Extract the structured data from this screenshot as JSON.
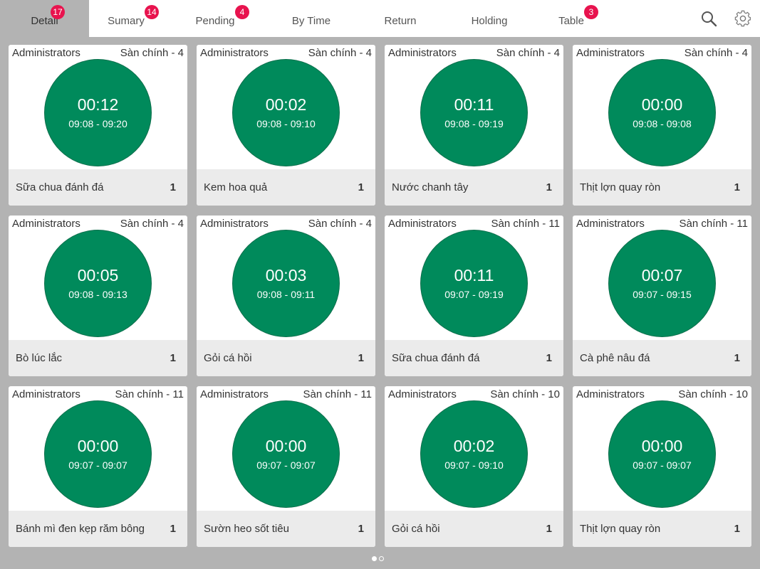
{
  "tabs": [
    {
      "label": "Detail",
      "badge": "17"
    },
    {
      "label": "Sumary",
      "badge": "14"
    },
    {
      "label": "Pending",
      "badge": "4"
    },
    {
      "label": "By Time",
      "badge": ""
    },
    {
      "label": "Return",
      "badge": ""
    },
    {
      "label": "Holding",
      "badge": ""
    },
    {
      "label": "Table",
      "badge": "3"
    }
  ],
  "active_tab": "Detail",
  "icons": {
    "search": "search-icon",
    "settings": "gear-icon"
  },
  "colors": {
    "timer": "#008a5b",
    "badge": "#e8134e",
    "background": "#b3b3b3"
  },
  "cards": [
    {
      "staff": "Administrators",
      "location": "Sàn chính - 4",
      "elapsed": "00:12",
      "range": "09:08 - 09:20",
      "dish": "Sữa chua đánh đá",
      "qty": "1"
    },
    {
      "staff": "Administrators",
      "location": "Sàn chính - 4",
      "elapsed": "00:02",
      "range": "09:08 - 09:10",
      "dish": "Kem hoa quả",
      "qty": "1"
    },
    {
      "staff": "Administrators",
      "location": "Sàn chính - 4",
      "elapsed": "00:11",
      "range": "09:08 - 09:19",
      "dish": "Nước chanh tây",
      "qty": "1"
    },
    {
      "staff": "Administrators",
      "location": "Sàn chính - 4",
      "elapsed": "00:00",
      "range": "09:08 - 09:08",
      "dish": "Thịt lợn quay ròn",
      "qty": "1"
    },
    {
      "staff": "Administrators",
      "location": "Sàn chính - 4",
      "elapsed": "00:05",
      "range": "09:08 - 09:13",
      "dish": "Bò lúc lắc",
      "qty": "1"
    },
    {
      "staff": "Administrators",
      "location": "Sàn chính - 4",
      "elapsed": "00:03",
      "range": "09:08 - 09:11",
      "dish": "Gỏi cá hồi",
      "qty": "1"
    },
    {
      "staff": "Administrators",
      "location": "Sàn chính - 11",
      "elapsed": "00:11",
      "range": "09:07 - 09:19",
      "dish": "Sữa chua đánh đá",
      "qty": "1"
    },
    {
      "staff": "Administrators",
      "location": "Sàn chính - 11",
      "elapsed": "00:07",
      "range": "09:07 - 09:15",
      "dish": "Cà phê nâu đá",
      "qty": "1"
    },
    {
      "staff": "Administrators",
      "location": "Sàn chính - 11",
      "elapsed": "00:00",
      "range": "09:07 - 09:07",
      "dish": "Bánh mì đen kẹp ră̆m bông",
      "qty": "1"
    },
    {
      "staff": "Administrators",
      "location": "Sàn chính - 11",
      "elapsed": "00:00",
      "range": "09:07 - 09:07",
      "dish": "Sườn heo sốt tiêu",
      "qty": "1"
    },
    {
      "staff": "Administrators",
      "location": "Sàn chính - 10",
      "elapsed": "00:02",
      "range": "09:07 - 09:10",
      "dish": "Gỏi cá hồi",
      "qty": "1"
    },
    {
      "staff": "Administrators",
      "location": "Sàn chính - 10",
      "elapsed": "00:00",
      "range": "09:07 - 09:07",
      "dish": "Thịt lợn quay ròn",
      "qty": "1"
    }
  ],
  "pager": {
    "pages": 2,
    "current": 1
  }
}
